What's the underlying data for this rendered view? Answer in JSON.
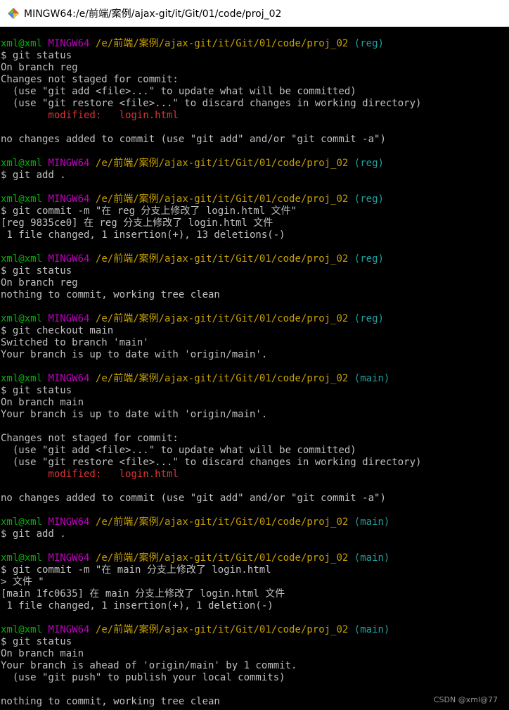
{
  "window": {
    "title": "MINGW64:/e/前端/案例/ajax-git/it/Git/01/code/proj_02",
    "icon": "mingw-diamond-icon"
  },
  "colors": {
    "background": "#000000",
    "text": "#c0c0c0",
    "user_host": "#00b400",
    "mingw": "#c000c0",
    "path": "#c8a000",
    "branch": "#20a0a0",
    "modified": "#e03434"
  },
  "prompt": {
    "user_host": "xml@xml",
    "system": "MINGW64",
    "path": "/e/前端/案例/ajax-git/it/Git/01/code/proj_02"
  },
  "terminal": {
    "blocks": [
      {
        "branch": "(reg)",
        "command": "$ git status",
        "output": [
          {
            "t": "On branch reg"
          },
          {
            "t": "Changes not staged for commit:"
          },
          {
            "t": "  (use \"git add <file>...\" to update what will be committed)"
          },
          {
            "t": "  (use \"git restore <file>...\" to discard changes in working directory)"
          },
          {
            "t": "        modified:   login.html",
            "s": "mod"
          },
          {
            "t": ""
          },
          {
            "t": "no changes added to commit (use \"git add\" and/or \"git commit -a\")"
          }
        ]
      },
      {
        "branch": "(reg)",
        "command": "$ git add .",
        "output": []
      },
      {
        "branch": "(reg)",
        "command": "$ git commit -m \"在 reg 分支上修改了 login.html 文件\"",
        "output": [
          {
            "t": "[reg 9835ce0] 在 reg 分支上修改了 login.html 文件"
          },
          {
            "t": " 1 file changed, 1 insertion(+), 13 deletions(-)"
          }
        ]
      },
      {
        "branch": "(reg)",
        "command": "$ git status",
        "output": [
          {
            "t": "On branch reg"
          },
          {
            "t": "nothing to commit, working tree clean"
          }
        ]
      },
      {
        "branch": "(reg)",
        "command": "$ git checkout main",
        "output": [
          {
            "t": "Switched to branch 'main'"
          },
          {
            "t": "Your branch is up to date with 'origin/main'."
          }
        ]
      },
      {
        "branch": "(main)",
        "command": "$ git status",
        "output": [
          {
            "t": "On branch main"
          },
          {
            "t": "Your branch is up to date with 'origin/main'."
          },
          {
            "t": ""
          },
          {
            "t": "Changes not staged for commit:"
          },
          {
            "t": "  (use \"git add <file>...\" to update what will be committed)"
          },
          {
            "t": "  (use \"git restore <file>...\" to discard changes in working directory)"
          },
          {
            "t": "        modified:   login.html",
            "s": "mod"
          },
          {
            "t": ""
          },
          {
            "t": "no changes added to commit (use \"git add\" and/or \"git commit -a\")"
          }
        ]
      },
      {
        "branch": "(main)",
        "command": "$ git add .",
        "output": []
      },
      {
        "branch": "(main)",
        "command": "$ git commit -m \"在 main 分支上修改了 login.html",
        "output": [
          {
            "t": "> 文件 \""
          },
          {
            "t": "[main 1fc0635] 在 main 分支上修改了 login.html 文件"
          },
          {
            "t": " 1 file changed, 1 insertion(+), 1 deletion(-)"
          }
        ]
      },
      {
        "branch": "(main)",
        "command": "$ git status",
        "output": [
          {
            "t": "On branch main"
          },
          {
            "t": "Your branch is ahead of 'origin/main' by 1 commit."
          },
          {
            "t": "  (use \"git push\" to publish your local commits)"
          },
          {
            "t": ""
          },
          {
            "t": "nothing to commit, working tree clean"
          }
        ]
      }
    ]
  },
  "watermark": "CSDN @xml@77"
}
